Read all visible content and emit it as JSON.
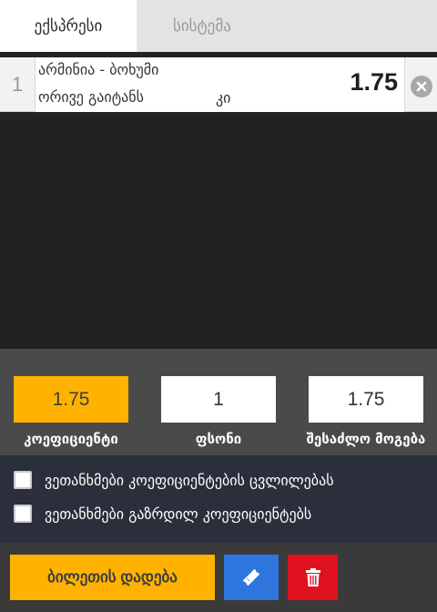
{
  "tabs": [
    {
      "label": "ექსპრესი",
      "active": true
    },
    {
      "label": "სისტემა",
      "active": false
    }
  ],
  "bet": {
    "index": "1",
    "match": "არმინია - ბოხუმი",
    "market": "ორივე გაიტანს",
    "pick": "კი",
    "odds": "1.75",
    "remove_icon": "close-circle-icon"
  },
  "summary": {
    "coefficient_value": "1.75",
    "coefficient_label": "კოეფიციენტი",
    "stake_value": "1",
    "stake_label": "ფსონი",
    "possible_win_value": "1.75",
    "possible_win_label": "შესაძლო მოგება"
  },
  "agreements": [
    {
      "label": "ვეთანხმები კოეფიციენტების ცვლილებას",
      "checked": false
    },
    {
      "label": "ვეთანხმები გაზრდილ კოეფიციენტებს",
      "checked": false
    }
  ],
  "actions": {
    "place_bet_label": "ბილეთის დადება",
    "ticket_icon": "ticket-icon",
    "delete_icon": "trash-icon"
  },
  "colors": {
    "accent": "#ffb300",
    "blue": "#2e76de",
    "red": "#e1121f",
    "dark_bg": "#222222"
  }
}
